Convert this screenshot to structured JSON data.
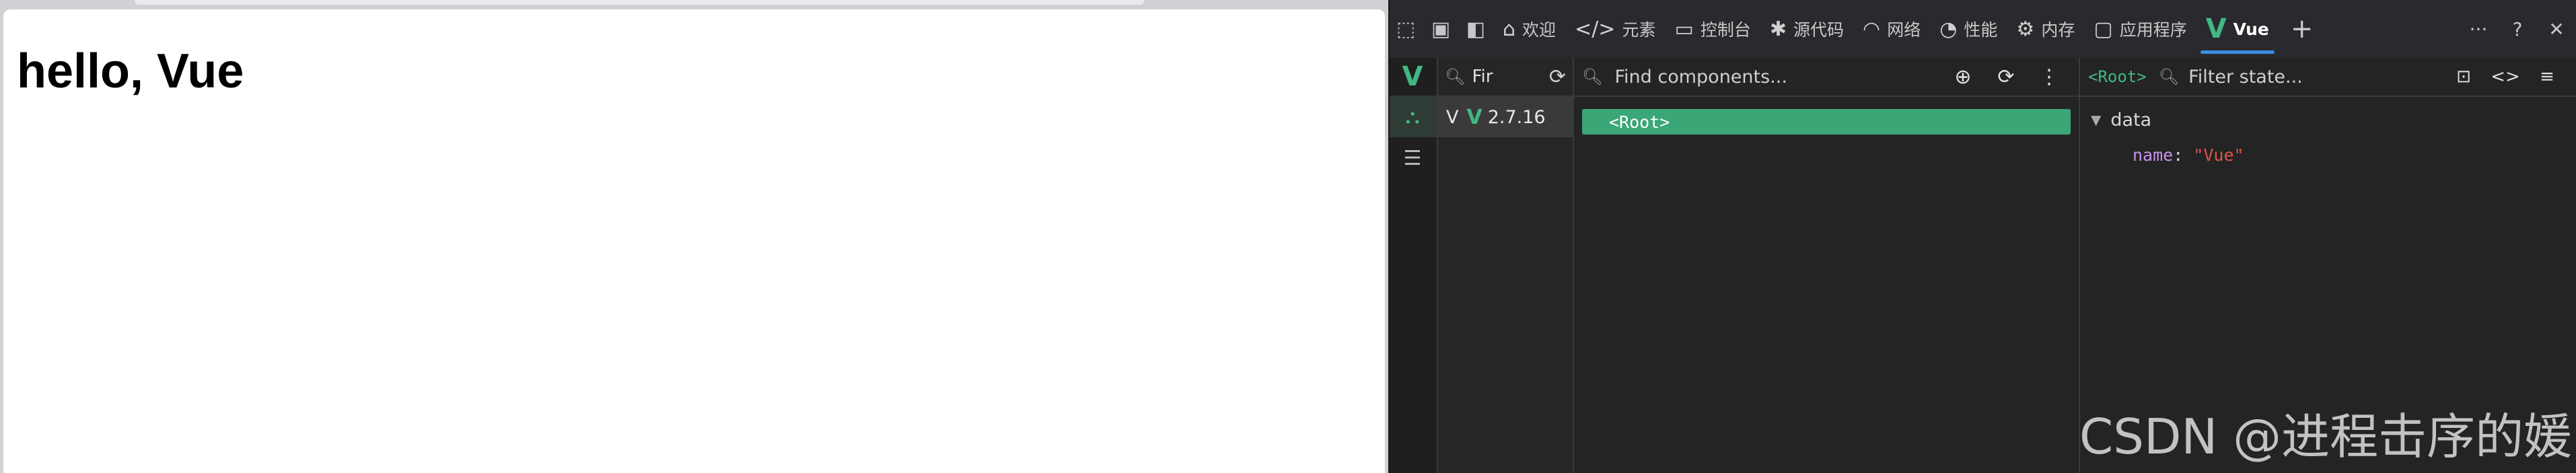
{
  "page": {
    "heading": "hello, Vue"
  },
  "devtools": {
    "toolbar": {
      "inspect_icon": "element-picker-icon",
      "device_icon": "device-emulation-icon",
      "dock_icon": "dock-side-icon"
    },
    "tabs": [
      {
        "label": "欢迎",
        "icon": "home-icon"
      },
      {
        "label": "元素",
        "icon": "code-tag-icon"
      },
      {
        "label": "控制台",
        "icon": "console-icon"
      },
      {
        "label": "源代码",
        "icon": "bug-icon"
      },
      {
        "label": "网络",
        "icon": "wifi-icon"
      },
      {
        "label": "性能",
        "icon": "gauge-icon"
      },
      {
        "label": "内存",
        "icon": "memory-chip-icon"
      },
      {
        "label": "应用程序",
        "icon": "window-icon"
      },
      {
        "label": "Vue",
        "icon": "vue-logo-icon",
        "active": true
      }
    ],
    "add_tab_label": "+",
    "right_actions": {
      "more": "···",
      "help": "?",
      "close": "✕"
    }
  },
  "vue": {
    "accent": "#41b883",
    "rail": [
      {
        "name": "vue-logo",
        "glyph": "V"
      },
      {
        "name": "components",
        "glyph": "⛬",
        "active": true
      },
      {
        "name": "timeline",
        "glyph": "☰"
      }
    ],
    "apps": {
      "search_text": "Fir",
      "items": [
        {
          "prefix": "V",
          "version": "2.7.16"
        }
      ]
    },
    "components": {
      "search_placeholder": "Find components...",
      "tree": [
        {
          "label": "<Root>"
        }
      ]
    },
    "inspector": {
      "selected": "<Root>",
      "filter_placeholder": "Filter state...",
      "section": "data",
      "props": [
        {
          "key": "name",
          "value": "\"Vue\""
        }
      ]
    }
  },
  "watermark": "CSDN @进程击序的媛"
}
